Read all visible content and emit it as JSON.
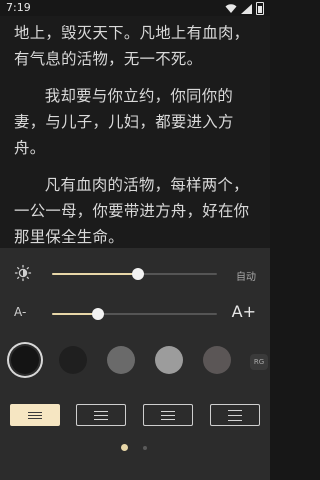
{
  "status": {
    "time": "7:19"
  },
  "reader": {
    "paragraphs": [
      "地上，毁灭天下。凡地上有血肉，有气息的活物，无一不死。",
      "我却要与你立约，你同你的妻，与儿子，儿妇，都要进入方舟。",
      "凡有血肉的活物，每样两个，一公一母，你要带进方舟，好在你那里保全生命。"
    ]
  },
  "settings": {
    "brightness": {
      "value": 0.52,
      "auto_label": "自动"
    },
    "font_size": {
      "minus_label": "A-",
      "plus_label": "A+",
      "value": 0.28
    },
    "themes": [
      {
        "name": "black",
        "color": "#141414",
        "selected": true
      },
      {
        "name": "dark",
        "color": "#1f1f1f",
        "selected": false
      },
      {
        "name": "gray",
        "color": "#6a6a6a",
        "selected": false
      },
      {
        "name": "light-gray",
        "color": "#9c9c9c",
        "selected": false
      },
      {
        "name": "taupe",
        "color": "#5b5656",
        "selected": false
      }
    ],
    "more_label": "RG",
    "spacing": [
      {
        "name": "compact",
        "active": true
      },
      {
        "name": "normal",
        "active": false
      },
      {
        "name": "relaxed",
        "active": false
      },
      {
        "name": "loose",
        "active": false
      }
    ],
    "pages": {
      "count": 2,
      "current": 1
    }
  },
  "colors": {
    "accent": "#e8d7a8",
    "panel": "#2c2c2c",
    "background": "#1b1b1b"
  }
}
